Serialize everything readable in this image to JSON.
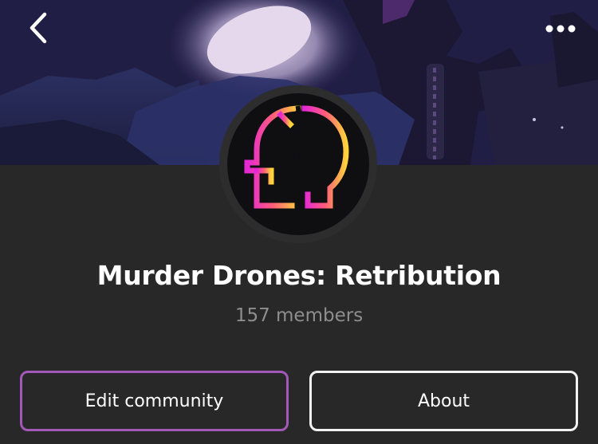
{
  "header": {
    "back_icon": "chevron-left-icon",
    "more_icon": "more-horizontal-icon"
  },
  "community": {
    "name": "Murder Drones: Retribution",
    "members": "157 members",
    "avatar_icon": "drone-logo-icon"
  },
  "actions": {
    "edit_label": "Edit community",
    "about_label": "About"
  },
  "colors": {
    "background": "#282828",
    "edit_border": "#a259b8",
    "about_border": "#f2f2f2",
    "logo_gradient_start": "#e528d6",
    "logo_gradient_end": "#ffd43a"
  }
}
